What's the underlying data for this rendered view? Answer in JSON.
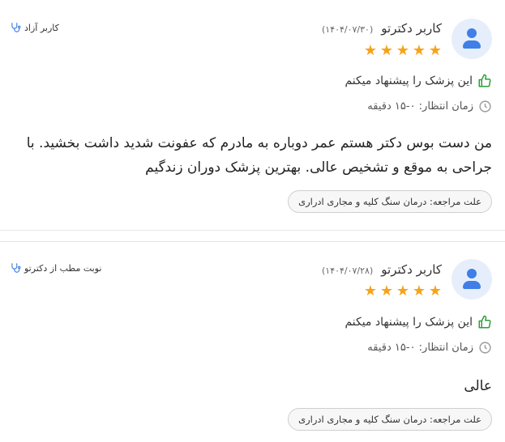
{
  "reviews": [
    {
      "user_name": "کاربر دکترتو",
      "date": "(۱۴۰۴/۰۷/۳۰)",
      "rating": 5,
      "tag": "کاربر آزاد",
      "recommend": "این پزشک را پیشنهاد میکنم",
      "wait_time": "زمان انتظار: ۰-۱۵ دقیقه",
      "comment": "من دست بوس دکتر هستم عمر دوباره به مادرم که عفونت شدید داشت بخشید. با جراحی به موقع و تشخیص عالی. بهترین پزشک دوران زندگیم",
      "reason": "علت مراجعه: درمان سنگ کلیه و مجاری ادراری"
    },
    {
      "user_name": "کاربر دکترتو",
      "date": "(۱۴۰۴/۰۷/۲۸)",
      "rating": 5,
      "tag": "نوبت مطب از دکترتو",
      "recommend": "این پزشک را پیشنهاد میکنم",
      "wait_time": "زمان انتظار: ۰-۱۵ دقیقه",
      "comment": "عالی",
      "reason": "علت مراجعه: درمان سنگ کلیه و مجاری ادراری"
    }
  ],
  "colors": {
    "star": "#f6a31a",
    "accent": "#3f7fe6",
    "thumb": "#2e9d3a"
  },
  "icons": [
    "user-avatar-icon",
    "star-icon",
    "stethoscope-icon",
    "thumbs-up-icon",
    "clock-icon"
  ]
}
